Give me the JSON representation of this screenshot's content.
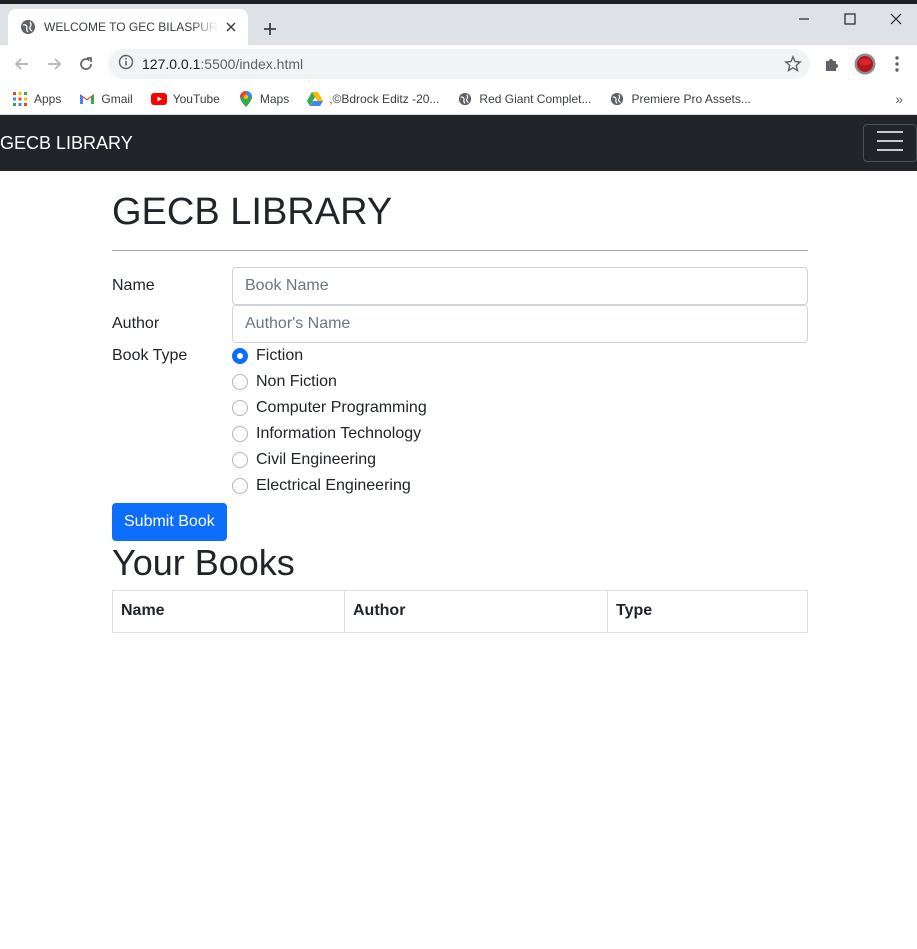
{
  "browser": {
    "tab_title": "WELCOME TO GEC BILASPUR LIBRARY",
    "url_host": "127.0.0.1",
    "url_path": ":5500/index.html",
    "bookmarks": [
      {
        "label": "Apps",
        "icon": "apps-grid-icon"
      },
      {
        "label": "Gmail",
        "icon": "gmail-icon"
      },
      {
        "label": "YouTube",
        "icon": "youtube-icon"
      },
      {
        "label": "Maps",
        "icon": "maps-icon"
      },
      {
        "label": ",©Bdrock Editz -20...",
        "icon": "google-drive-icon"
      },
      {
        "label": "Red Giant Complet...",
        "icon": "globe-icon"
      },
      {
        "label": "Premiere Pro Assets...",
        "icon": "globe-icon"
      }
    ],
    "bookmarks_more": "»"
  },
  "navbar": {
    "brand": "GECB LIBRARY"
  },
  "main": {
    "title": "GECB LIBRARY",
    "form": {
      "name_label": "Name",
      "name_placeholder": "Book Name",
      "author_label": "Author",
      "author_placeholder": "Author's Name",
      "type_label": "Book Type",
      "types": [
        {
          "label": "Fiction",
          "checked": true
        },
        {
          "label": "Non Fiction",
          "checked": false
        },
        {
          "label": "Computer Programming",
          "checked": false
        },
        {
          "label": "Information Technology",
          "checked": false
        },
        {
          "label": "Civil Engineering",
          "checked": false
        },
        {
          "label": "Electrical Engineering",
          "checked": false
        }
      ],
      "submit_label": "Submit Book"
    },
    "books_title": "Your Books",
    "table_headers": [
      "Name",
      "Author",
      "Type"
    ]
  },
  "colors": {
    "navbar_bg": "#212529",
    "primary": "#0d6efd"
  }
}
